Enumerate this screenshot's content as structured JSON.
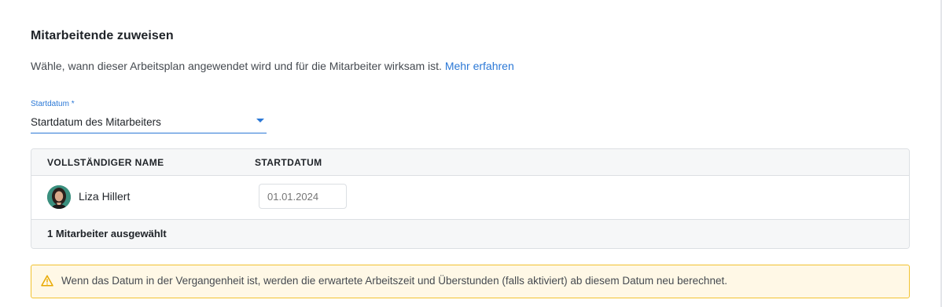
{
  "section": {
    "title": "Mitarbeitende zuweisen",
    "description": "Wähle, wann dieser Arbeitsplan angewendet wird und für die Mitarbeiter wirksam ist.",
    "learn_more_link": "Mehr erfahren"
  },
  "start_select": {
    "label": "Startdatum *",
    "value": "Startdatum des Mitarbeiters"
  },
  "table": {
    "columns": [
      "VOLLSTÄNDIGER NAME",
      "STARTDATUM"
    ],
    "rows": [
      {
        "name": "Liza Hillert",
        "start_date_placeholder": "01.01.2024"
      }
    ],
    "footer": "1 Mitarbeiter ausgewählt"
  },
  "alert": {
    "icon": "warning-icon",
    "text": "Wenn das Datum in der Vergangenheit ist, werden die erwartete Arbeitszeit und Überstunden (falls aktiviert) ab diesem Datum neu berechnet."
  },
  "colors": {
    "accent": "#2b78d6",
    "warning_border": "#f2c230",
    "warning_bg": "#fff8e6"
  }
}
